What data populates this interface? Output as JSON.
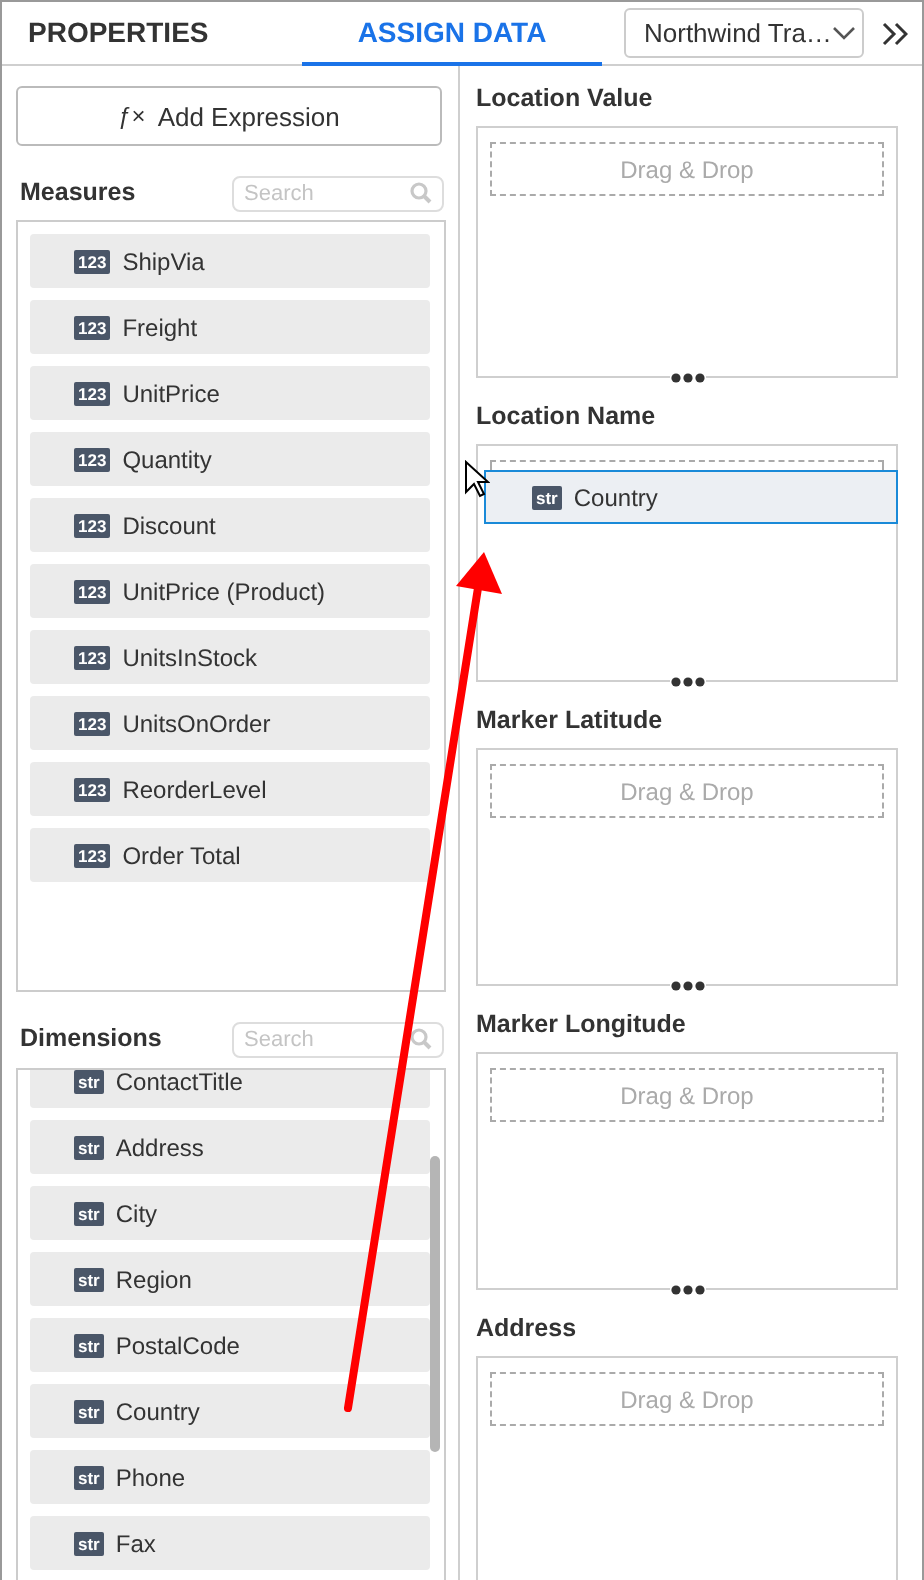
{
  "tabs": [
    {
      "label": "PROPERTIES",
      "selected": false
    },
    {
      "label": "ASSIGN DATA",
      "selected": true
    }
  ],
  "datasource": {
    "value": "Northwind Tra…"
  },
  "add_expression": {
    "icon": "ƒ×",
    "label": "Add Expression"
  },
  "measures": {
    "title": "Measures",
    "search_placeholder": "Search",
    "items": [
      {
        "badge": "123",
        "name": "ShipVia"
      },
      {
        "badge": "123",
        "name": "Freight"
      },
      {
        "badge": "123",
        "name": "UnitPrice"
      },
      {
        "badge": "123",
        "name": "Quantity"
      },
      {
        "badge": "123",
        "name": "Discount"
      },
      {
        "badge": "123",
        "name": "UnitPrice (Product)"
      },
      {
        "badge": "123",
        "name": "UnitsInStock"
      },
      {
        "badge": "123",
        "name": "UnitsOnOrder"
      },
      {
        "badge": "123",
        "name": "ReorderLevel"
      },
      {
        "badge": "123",
        "name": "Order Total"
      }
    ]
  },
  "dimensions": {
    "title": "Dimensions",
    "search_placeholder": "Search",
    "items": [
      {
        "badge": "str",
        "name": "ContactTitle"
      },
      {
        "badge": "str",
        "name": "Address"
      },
      {
        "badge": "str",
        "name": "City"
      },
      {
        "badge": "str",
        "name": "Region"
      },
      {
        "badge": "str",
        "name": "PostalCode"
      },
      {
        "badge": "str",
        "name": "Country"
      },
      {
        "badge": "str",
        "name": "Phone"
      },
      {
        "badge": "str",
        "name": "Fax"
      }
    ]
  },
  "wells": [
    {
      "title": "Location Value",
      "placeholder": "Drag & Drop"
    },
    {
      "title": "Location Name",
      "dragged_item": {
        "badge": "str",
        "name": "Country"
      }
    },
    {
      "title": "Marker Latitude",
      "placeholder": "Drag & Drop"
    },
    {
      "title": "Marker Longitude",
      "placeholder": "Drag & Drop"
    },
    {
      "title": "Address",
      "placeholder": "Drag & Drop"
    }
  ]
}
